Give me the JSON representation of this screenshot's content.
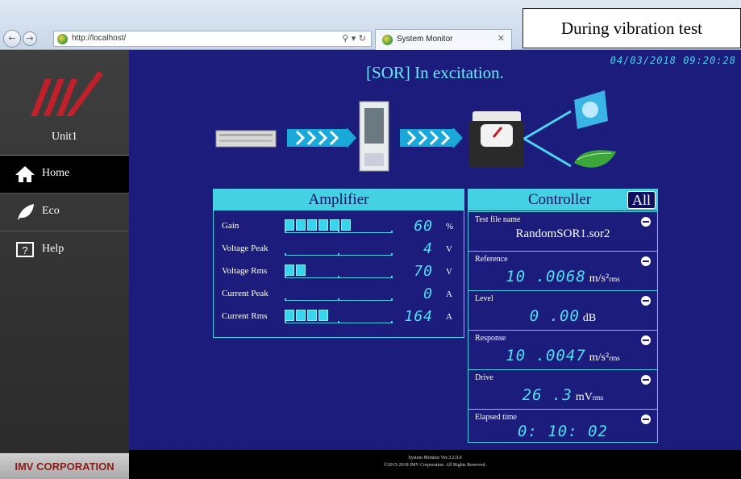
{
  "browser": {
    "url": "http://localhost/",
    "tab_title": "System Monitor",
    "address_controls": "⚲ ▾ ↻",
    "tab_close": "✕",
    "back": "←",
    "forward": "→"
  },
  "caption": "During vibration test",
  "sidebar": {
    "unit": "Unit1",
    "items": [
      {
        "label": "Home",
        "icon": "home-icon",
        "active": true
      },
      {
        "label": "Eco",
        "icon": "leaf-icon",
        "active": false
      },
      {
        "label": "Help",
        "icon": "help-icon",
        "active": false
      }
    ],
    "corporation": "IMV CORPORATION",
    "help_glyph": "?"
  },
  "main": {
    "datetime": "04/03/2018 09:20:28",
    "status": "[SOR] In excitation.",
    "accent_color": "#45d1e4",
    "value_color": "#4fe0f3"
  },
  "amplifier": {
    "title": "Amplifier",
    "rows": [
      {
        "label": "Gain",
        "value": "60",
        "unit": "%",
        "segments": 6
      },
      {
        "label": "Voltage Peak",
        "value": "4",
        "unit": "V",
        "segments": 0
      },
      {
        "label": "Voltage Rms",
        "value": "70",
        "unit": "V",
        "segments": 2
      },
      {
        "label": "Current Peak",
        "value": "0",
        "unit": "A",
        "segments": 0
      },
      {
        "label": "Current Rms",
        "value": "164",
        "unit": "A",
        "segments": 4
      }
    ]
  },
  "controller": {
    "title": "Controller",
    "all_button": "All",
    "rows": [
      {
        "label": "Test file name",
        "text": "RandomSOR1.sor2"
      },
      {
        "label": "Reference",
        "value": "10 .0068",
        "unit": "m/s²",
        "sub": "rms"
      },
      {
        "label": "Level",
        "value": "0 .00",
        "unit": "dB",
        "sub": ""
      },
      {
        "label": "Response",
        "value": "10 .0047",
        "unit": "m/s²",
        "sub": "rms"
      },
      {
        "label": "Drive",
        "value": "26 .3",
        "unit": "mV",
        "sub": "rms"
      },
      {
        "label": "Elapsed time",
        "value": "0: 10: 02",
        "unit": "",
        "sub": ""
      }
    ]
  },
  "footer": {
    "version": "System Monitor Ver.3.2.0.0",
    "copyright": "©2015-2018 IMV Corporation. All Rights Reserved."
  }
}
